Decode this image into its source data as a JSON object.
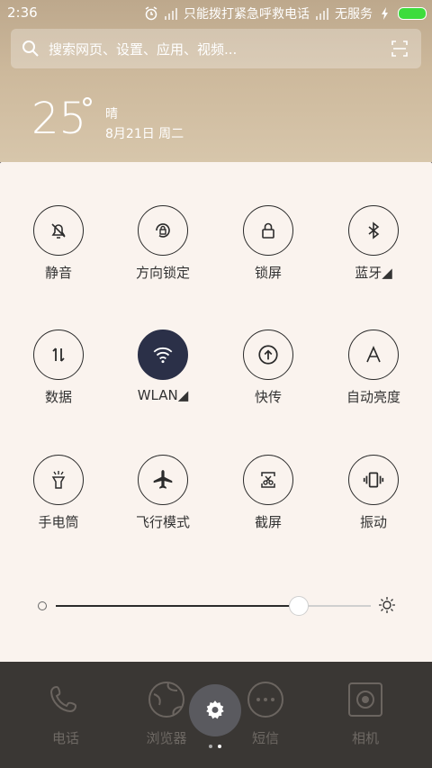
{
  "status": {
    "time": "2:36",
    "emergency_text": "只能拨打紧急呼救电话",
    "no_service": "无服务"
  },
  "search": {
    "placeholder": "搜索网页、设置、应用、视频..."
  },
  "weather": {
    "temp": "25",
    "deg": "°",
    "condition": "晴",
    "date": "8月21日 周二"
  },
  "tiles": [
    {
      "label": "静音",
      "icon": "bell-off-icon"
    },
    {
      "label": "方向锁定",
      "icon": "rotation-lock-icon"
    },
    {
      "label": "锁屏",
      "icon": "lock-icon"
    },
    {
      "label": "蓝牙◢",
      "icon": "bluetooth-icon"
    },
    {
      "label": "数据",
      "icon": "data-arrows-icon"
    },
    {
      "label": "WLAN◢",
      "icon": "wifi-icon"
    },
    {
      "label": "快传",
      "icon": "upload-icon"
    },
    {
      "label": "自动亮度",
      "icon": "auto-brightness-icon"
    },
    {
      "label": "手电筒",
      "icon": "flashlight-icon"
    },
    {
      "label": "飞行模式",
      "icon": "airplane-icon"
    },
    {
      "label": "截屏",
      "icon": "screenshot-icon"
    },
    {
      "label": "振动",
      "icon": "vibrate-icon"
    }
  ],
  "brightness": {
    "level": 0.77
  },
  "dock": {
    "apps": [
      {
        "label": "电话",
        "icon": "phone-icon"
      },
      {
        "label": "浏览器",
        "icon": "browser-icon"
      },
      {
        "label": "短信",
        "icon": "message-icon"
      },
      {
        "label": "相机",
        "icon": "camera-icon"
      }
    ],
    "center_icon": "gear-icon"
  },
  "colors": {
    "panel_bg": "#faf3ee",
    "active_tile": "#2b3048",
    "battery": "#3ddc3d"
  }
}
